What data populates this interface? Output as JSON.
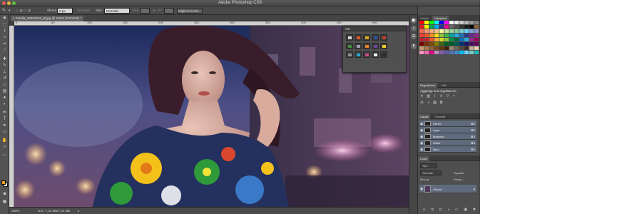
{
  "window": {
    "title": "Adobe Photoshop CS6"
  },
  "options_bar": {
    "tool_icon": "brush-icon",
    "size_label": "Sfuma:",
    "size_value": "0 px",
    "anti_alias_label": "Anti-alias",
    "style_label": "Stile:",
    "style_value": "Normale",
    "width_label": "Larg.:",
    "height_label": "Alt.:",
    "refine_button": "Migliora bordo...",
    "workspace_button": "Essenziali"
  },
  "document": {
    "tab_label": "Fotolia_34291515_M.jpg @ 100% (CMYK/8) *",
    "ruler_marks": [
      "0",
      "50",
      "100",
      "150",
      "200",
      "250",
      "300",
      "350",
      "400",
      "450",
      "500"
    ],
    "zoom": "100%",
    "doc_size": "Doc: 7,22 MB/7,22 MB"
  },
  "swatches_popover": {
    "title": "Stili",
    "cells": [
      {
        "icon": "none-style-icon",
        "color": "#d8d8d8"
      },
      {
        "icon": "fire-style-icon",
        "color": "#e0571b"
      },
      {
        "icon": "gold-style-icon",
        "color": "#d6a81f"
      },
      {
        "icon": "blue-style-icon",
        "color": "#2c4fa8"
      },
      {
        "icon": "red-style-icon",
        "color": "#c43b2e"
      },
      {
        "icon": "green-style-icon",
        "color": "#3f8f3a"
      },
      {
        "icon": "chrome-style-icon",
        "color": "#9aa2ad"
      },
      {
        "icon": "orange-style-icon",
        "color": "#e8842a"
      },
      {
        "icon": "purple-style-icon",
        "color": "#6b4aa0"
      },
      {
        "icon": "yellow-style-icon",
        "color": "#f2d12a"
      },
      {
        "icon": "grey-style-icon",
        "color": "#8f8f8f"
      },
      {
        "icon": "cyan-style-icon",
        "color": "#2aa7d6"
      },
      {
        "icon": "pink-style-icon",
        "color": "#cf4a8c"
      },
      {
        "icon": "white-style-icon",
        "color": "#f2f2f2"
      },
      {
        "icon": "dark-style-icon",
        "color": "#2b2b2b"
      }
    ]
  },
  "panels": {
    "color_tabs": [
      "Colore",
      "Campioni"
    ],
    "swatch_colors": [
      "#ff0000",
      "#ffff00",
      "#00ff00",
      "#00ffff",
      "#0000ff",
      "#ff00ff",
      "#ffffff",
      "#e6e6e6",
      "#cccccc",
      "#b3b3b3",
      "#999999",
      "#808080",
      "#ed1c24",
      "#fff200",
      "#00a651",
      "#00aeef",
      "#2e3192",
      "#ec008c",
      "#666666",
      "#4d4d4d",
      "#333333",
      "#1a1a1a",
      "#000000",
      "#8c6239",
      "#f26c4f",
      "#f7977a",
      "#fbad82",
      "#fdc689",
      "#fff79a",
      "#c4df9b",
      "#a3d39c",
      "#82ca9c",
      "#7bcdc8",
      "#6ecff6",
      "#7ea7d8",
      "#8493ca",
      "#ef4136",
      "#f15a29",
      "#f7941d",
      "#ffde17",
      "#8dc63f",
      "#39b54a",
      "#00a99d",
      "#27aae1",
      "#1c75bc",
      "#2b3990",
      "#662d91",
      "#92278f",
      "#be1e2d",
      "#c1272d",
      "#f15a24",
      "#fbb03b",
      "#d9e021",
      "#8cc63f",
      "#009245",
      "#006837",
      "#0071bc",
      "#29abe2",
      "#93278f",
      "#9e005d",
      "#790000",
      "#7b2e00",
      "#7d4900",
      "#827b00",
      "#406618",
      "#005e20",
      "#005826",
      "#005952",
      "#003471",
      "#1b1464",
      "#440e62",
      "#630460",
      "#c69c6d",
      "#a67c52",
      "#8c6239",
      "#754c24",
      "#603913",
      "#42210b",
      "#998675",
      "#736357",
      "#534741",
      "#362f2d",
      "#c7b299",
      "#e6d2b5",
      "#f49ac1",
      "#f06eaa",
      "#ec008c",
      "#bd8cbf",
      "#8560a8",
      "#605ca8",
      "#5674b9",
      "#448ccb",
      "#00bff3",
      "#6dcff6",
      "#7accc8",
      "#1cbbb4"
    ],
    "adjust_tabs": [
      "Regolazioni",
      "Stili"
    ],
    "adjust_title": "Aggiungi una regolazione",
    "adjust_icons": [
      "brightness-icon",
      "levels-icon",
      "curves-icon",
      "exposure-icon",
      "vibrance-icon",
      "hue-icon",
      "balance-icon",
      "bw-icon",
      "photo-filter-icon",
      "channel-mixer-icon"
    ],
    "channels_tabs": [
      "Canali",
      "Tracciati"
    ],
    "channels": [
      {
        "name": "CMYK",
        "shortcut": "⌘2"
      },
      {
        "name": "Cyan",
        "shortcut": "⌘3"
      },
      {
        "name": "Magenta",
        "shortcut": "⌘4"
      },
      {
        "name": "Giallo",
        "shortcut": "⌘5"
      },
      {
        "name": "Nero",
        "shortcut": "⌘6"
      }
    ],
    "layers_tabs": [
      "Livelli"
    ],
    "layers_kind": "Tipo",
    "blend_mode": "Normale",
    "opacity_label": "Opacità:",
    "lock_label": "Blocca:",
    "fill_label": "Riemp.:",
    "layers": [
      {
        "name": "Sfondo"
      }
    ]
  },
  "colors": {
    "foreground": "#f39a1a",
    "background": "#ffffff",
    "accent": "#5f6b7d"
  }
}
